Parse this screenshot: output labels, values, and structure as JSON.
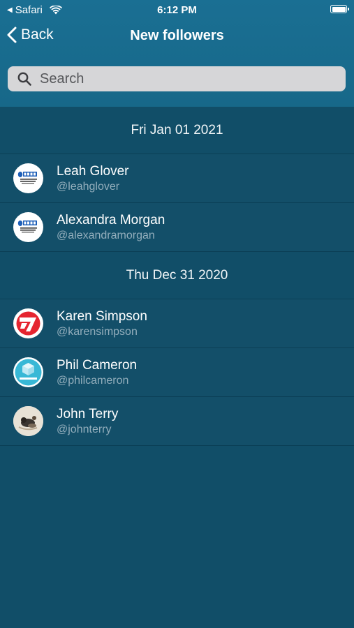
{
  "status_bar": {
    "app": "Safari",
    "time": "6:12 PM"
  },
  "nav": {
    "back_label": "Back",
    "title": "New followers"
  },
  "search": {
    "placeholder": "Search"
  },
  "sections": [
    {
      "date": "Fri Jan 01 2021",
      "rows": [
        {
          "name": "Leah Glover",
          "handle": "@leahglover",
          "avatar": "logo-avatar"
        },
        {
          "name": "Alexandra Morgan",
          "handle": "@alexandramorgan",
          "avatar": "logo-avatar"
        }
      ]
    },
    {
      "date": "Thu Dec 31 2020",
      "rows": [
        {
          "name": "Karen Simpson",
          "handle": "@karensimpson",
          "avatar": "red-seven-avatar"
        },
        {
          "name": "Phil Cameron",
          "handle": "@philcameron",
          "avatar": "cyan-box-avatar"
        },
        {
          "name": "John Terry",
          "handle": "@johnterry",
          "avatar": "photo-avatar"
        }
      ]
    }
  ],
  "colors": {
    "header_bg": "#1a6f93",
    "page_bg": "#114e68",
    "handle_text": "#93aebc"
  }
}
